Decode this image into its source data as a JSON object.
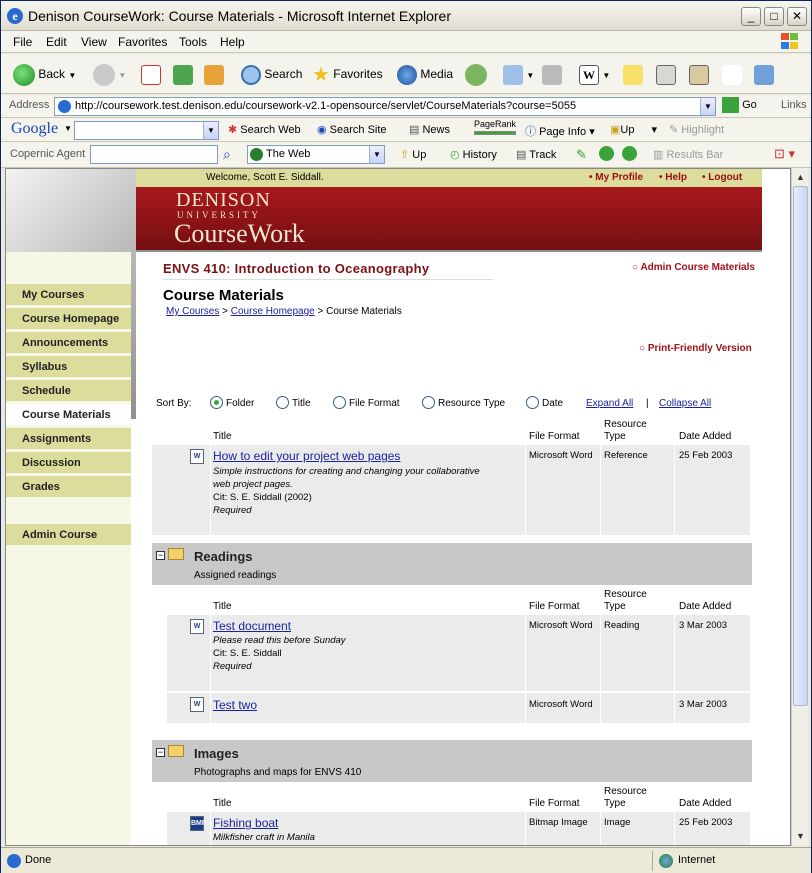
{
  "window": {
    "title": "Denison CourseWork: Course Materials - Microsoft Internet Explorer",
    "min": "_",
    "max": "□",
    "close": "✕"
  },
  "menu": [
    "File",
    "Edit",
    "View",
    "Favorites",
    "Tools",
    "Help"
  ],
  "toolbar": {
    "back": "Back",
    "search": "Search",
    "favorites": "Favorites",
    "media": "Media"
  },
  "address": {
    "label": "Address",
    "url": "http://coursework.test.denison.edu/coursework-v2.1-opensource/servlet/CourseMaterials?course=5055",
    "go": "Go",
    "links": "Links"
  },
  "google": {
    "logo": "Google",
    "search_web": "Search Web",
    "search_site": "Search Site",
    "news": "News",
    "pagerank": "PageRank",
    "page_info": "Page Info",
    "up": "Up",
    "highlight": "Highlight"
  },
  "copernic": {
    "label": "Copernic Agent",
    "scope": "The Web",
    "up": "Up",
    "history": "History",
    "track": "Track",
    "results_bar": "Results Bar"
  },
  "page": {
    "welcome": "Welcome, Scott E. Siddall.",
    "top_links": [
      "My Profile",
      "Help",
      "Logout"
    ],
    "brand_name": "DENISON",
    "brand_sub": "UNIVERSITY",
    "brand_product": "CourseWork",
    "course_title": "ENVS 410: Introduction to Oceanography",
    "admin_materials": "Admin Course Materials",
    "title": "Course Materials",
    "crumbs": [
      "My Courses",
      "Course Homepage",
      "Course Materials"
    ],
    "print_friendly": "Print-Friendly Version",
    "sidebar": [
      "My Courses",
      "Course Homepage",
      "Announcements",
      "Syllabus",
      "Schedule",
      "Course Materials",
      "Assignments",
      "Discussion",
      "Grades"
    ],
    "sidebar_admin": "Admin Course",
    "sort": {
      "label": "Sort By:",
      "options": [
        "Folder",
        "Title",
        "File Format",
        "Resource Type",
        "Date"
      ],
      "selected": "Folder",
      "expand_all": "Expand All",
      "collapse_all": "Collapse All"
    },
    "columns": {
      "title": "Title",
      "format": "File Format",
      "type_line1": "Resource",
      "type_line2": "Type",
      "date": "Date Added"
    },
    "top_items": [
      {
        "title": "How to edit your project web pages",
        "desc1": "Simple instructions for creating and changing your collaborative",
        "desc2": "web project pages.",
        "cit": "Cit: S. E. Siddall (2002)",
        "req": "Required",
        "format": "Microsoft Word",
        "type": "Reference",
        "date": "25 Feb 2003"
      }
    ],
    "folders": [
      {
        "name": "Readings",
        "desc": "Assigned readings",
        "items": [
          {
            "title": "Test document",
            "desc1": "Please read this before Sunday",
            "cit": "Cit: S. E. Siddall",
            "req": "Required",
            "format": "Microsoft Word",
            "type": "Reading",
            "date": "3 Mar 2003"
          },
          {
            "title": "Test two",
            "format": "Microsoft Word",
            "type": "",
            "date": "3 Mar 2003"
          }
        ]
      },
      {
        "name": "Images",
        "desc": "Photographs and maps for ENVS 410",
        "items": [
          {
            "title": "Fishing boat",
            "desc1": "Milkfisher craft in Manila",
            "format": "Bitmap Image",
            "type": "Image",
            "date": "25 Feb 2003"
          }
        ]
      }
    ]
  },
  "status": {
    "text": "Done",
    "zone": "Internet"
  }
}
